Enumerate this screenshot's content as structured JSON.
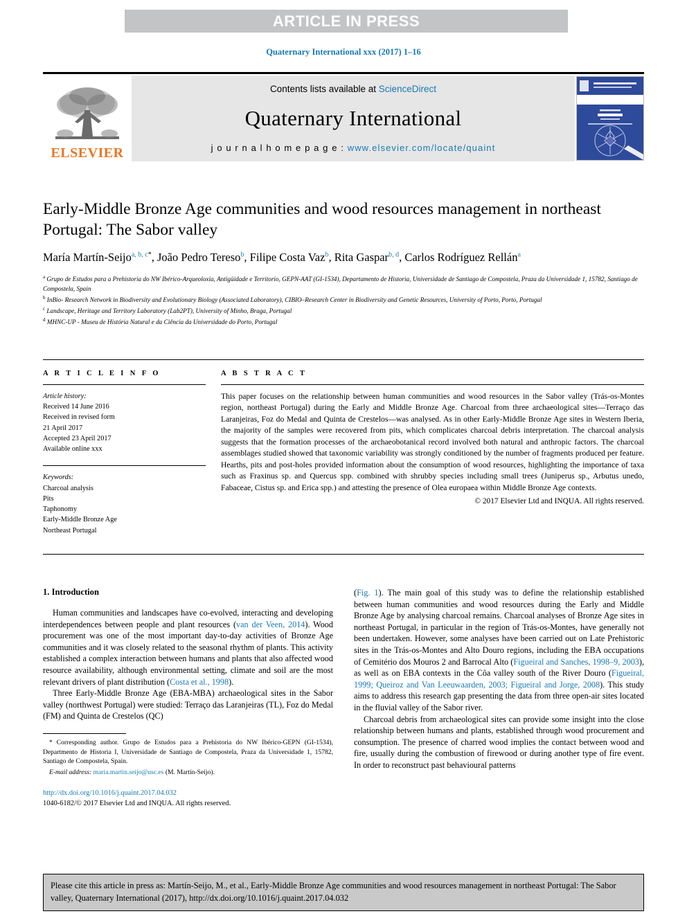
{
  "banner": {
    "text": "ARTICLE IN PRESS"
  },
  "running_head": "Quaternary International xxx (2017) 1–16",
  "masthead": {
    "publisher_logo_text": "ELSEVIER",
    "contents_prefix": "Contents lists available at ",
    "contents_link": "ScienceDirect",
    "journal_title": "Quaternary International",
    "homepage_prefix": "j o u r n a l   h o m e p a g e :  ",
    "homepage_url": "www.elsevier.com/locate/quaint",
    "cover_caption": "QUATERNARY INTERNATIONAL"
  },
  "article": {
    "title": "Early-Middle Bronze Age communities and wood resources management in northeast Portugal: The Sabor valley",
    "authors": [
      {
        "name": "María Martín-Seijo",
        "marks": "a, b, c",
        "star": true
      },
      {
        "name": "João Pedro Tereso",
        "marks": "b",
        "star": false
      },
      {
        "name": "Filipe Costa Vaz",
        "marks": "b",
        "star": false
      },
      {
        "name": "Rita Gaspar",
        "marks": "b, d",
        "star": false
      },
      {
        "name": "Carlos Rodríguez Rellán",
        "marks": "a",
        "star": false
      }
    ],
    "affiliations": [
      {
        "mark": "a",
        "text": "Grupo de Estudos para a Prehistoria do NW Ibérico-Arqueoloxía, Antigüidade e Territorio, GEPN-AAT (GI-1534), Departamento de Historia, Universidade de Santiago de Compostela, Praza da Universidade 1, 15782, Santiago de Compostela, Spain"
      },
      {
        "mark": "b",
        "text": "InBio- Research Network in Biodiversity and Evolutionary Biology (Associated Laboratory), CIBIO–Research Center in Biodiversity and Genetic Resources, University of Porto, Porto, Portugal"
      },
      {
        "mark": "c",
        "text": "Landscape, Heritage and Territory Laboratory (Lab2PT), University of Minho, Braga, Portugal"
      },
      {
        "mark": "d",
        "text": "MHNC-UP - Museu de História Natural e da Ciência da Universidade do Porto, Portugal"
      }
    ]
  },
  "article_info": {
    "heading": "A R T I C L E  I N F O",
    "history_label": "Article history:",
    "history": [
      "Received 14 June 2016",
      "Received in revised form",
      "21 April 2017",
      "Accepted 23 April 2017",
      "Available online xxx"
    ],
    "keywords_label": "Keywords:",
    "keywords": [
      "Charcoal analysis",
      "Pits",
      "Taphonomy",
      "Early-Middle Bronze Age",
      "Northeast Portugal"
    ]
  },
  "abstract": {
    "heading": "A B S T R A C T",
    "paragraphs": [
      "This paper focuses on the relationship between human communities and wood resources in the Sabor valley (Trás-os-Montes region, northeast Portugal) during the Early and Middle Bronze Age. Charcoal from three archaeological sites—Terraço das Laranjeiras, Foz do Medal and Quinta de Crestelos—was analysed. As in other Early-Middle Bronze Age sites in Western Iberia, the majority of the samples were recovered from pits, which complicates charcoal debris interpretation. The charcoal analysis suggests that the formation processes of the archaeobotanical record involved both natural and anthropic factors. The charcoal assemblages studied showed that taxonomic variability was strongly conditioned by the number of fragments produced per feature. Hearths, pits and post-holes provided information about the consumption of wood resources, highlighting the importance of taxa such as Fraxinus sp. and Quercus spp. combined with shrubby species including small trees (Juniperus sp., Arbutus unedo, Fabaceae, Cistus sp. and Erica spp.) and attesting the presence of Olea europaea within Middle Bronze Age contexts."
    ],
    "copyright": "© 2017 Elsevier Ltd and INQUA. All rights reserved."
  },
  "body": {
    "section_number_title": "1.  Introduction",
    "left_paragraphs": [
      "Human communities and landscapes have co-evolved, interacting and developing interdependences between people and plant resources (van der Veen, 2014). Wood procurement was one of the most important day-to-day activities of Bronze Age communities and it was closely related to the seasonal rhythm of plants. This activity established a complex interaction between humans and plants that also affected wood resource availability, although environmental setting, climate and soil are the most relevant drivers of plant distribution (Costa et al., 1998).",
      "Three Early-Middle Bronze Age (EBA-MBA) archaeological sites in the Sabor valley (northwest Portugal) were studied: Terraço das Laranjeiras (TL), Foz do Medal (FM) and Quinta de Crestelos (QC)"
    ],
    "right_paragraphs": [
      "(Fig. 1). The main goal of this study was to define the relationship established between human communities and wood resources during the Early and Middle Bronze Age by analysing charcoal remains. Charcoal analyses of Bronze Age sites in northeast Portugal, in particular in the region of Trás-os-Montes, have generally not been undertaken. However, some analyses have been carried out on Late Prehistoric sites in the Trás-os-Montes and Alto Douro regions, including the EBA occupations of Cemitério dos Mouros 2 and Barrocal Alto (Figueiral and Sanches, 1998–9, 2003), as well as on EBA contexts in the Côa valley south of the River Douro (Figueiral, 1999; Queiroz and Van Leeuwaarden, 2003; Figueiral and Jorge, 2008). This study aims to address this research gap presenting the data from three open-air sites located in the fluvial valley of the Sabor river.",
      "Charcoal debris from archaeological sites can provide some insight into the close relationship between humans and plants, established through wood procurement and consumption. The presence of charred wood implies the contact between wood and fire, usually during the combustion of firewood or during another type of fire event. In order to reconstruct past behavioural patterns"
    ],
    "inline_refs_left": [
      "van der Veen, 2014",
      "Costa et al., 1998"
    ],
    "inline_refs_right": [
      "Fig. 1",
      "Figueiral and Sanches, 1998–9, 2003",
      "Figueiral, 1999; Queiroz and Van Leeuwaarden, 2003; Figueiral and Jorge, 2008"
    ]
  },
  "footnote": {
    "star": "*",
    "corresponding": "Corresponding author. Grupo de Estudos para a Prehistoria do NW Ibérico-GEPN (GI-1534), Departmento de Historia I, Universidade de Santiago de Compostela, Praza da Universidade 1, 15782, Santiago de Compostela, Spain.",
    "email_label": "E-mail address:",
    "email": "maria.martin.seijo@usc.es",
    "email_owner": "(M. Martín-Seijo)."
  },
  "doi_block": {
    "doi_url": "http://dx.doi.org/10.1016/j.quaint.2017.04.032",
    "issn_line": "1040-6182/© 2017 Elsevier Ltd and INQUA. All rights reserved."
  },
  "cite_box": {
    "text": "Please cite this article in press as: Martín-Seijo, M., et al., Early-Middle Bronze Age communities and wood resources management in northeast Portugal: The Sabor valley, Quaternary International (2017), http://dx.doi.org/10.1016/j.quaint.2017.04.032"
  },
  "colors": {
    "link": "#1879b4",
    "banner_bg": "#c3c4c6",
    "masthead_bg": "#e6e6e6",
    "cite_bg": "#c9c9c9",
    "elsevier_orange": "#e87722",
    "cover_blue": "#2e4a9a"
  }
}
